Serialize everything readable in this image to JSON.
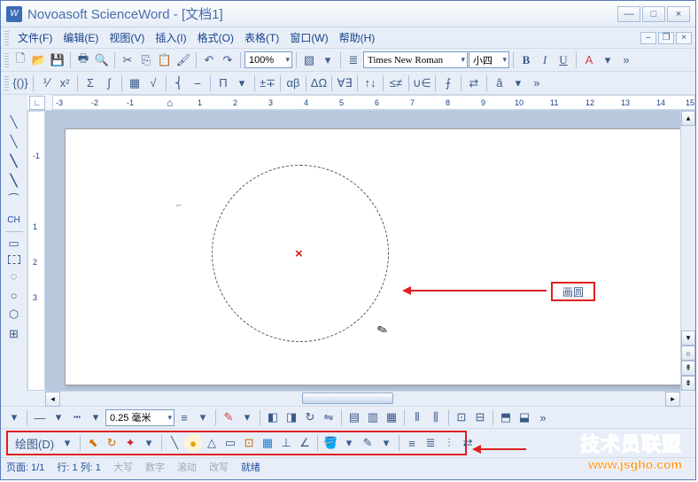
{
  "title": "Novoasoft ScienceWord - [文档1]",
  "menu": [
    "文件(F)",
    "编辑(E)",
    "视图(V)",
    "插入(I)",
    "格式(O)",
    "表格(T)",
    "窗口(W)",
    "帮助(H)"
  ],
  "zoom": "100%",
  "font": "Times New Roman",
  "size": "小四",
  "bold": "B",
  "italic": "I",
  "underline": "U",
  "ruler_h": [
    "-3",
    "-2",
    "-1",
    "1",
    "2",
    "3",
    "4",
    "5",
    "6",
    "7",
    "8",
    "9",
    "10",
    "11",
    "12",
    "13",
    "14",
    "15"
  ],
  "ruler_v": [
    "-1",
    "1",
    "2",
    "3"
  ],
  "callout": "画圆",
  "line_width": "0.25 毫米",
  "draw_menu": "绘图(D)",
  "status": {
    "page": "页面: 1/1",
    "pos": "行: 1 列: 1",
    "caps": "大写",
    "num": "数字",
    "scroll": "滚动",
    "ovr": "改写",
    "ready": "就绪"
  },
  "watermark": {
    "t1": "技术员联盟",
    "t2": "www.jsgho.com"
  }
}
